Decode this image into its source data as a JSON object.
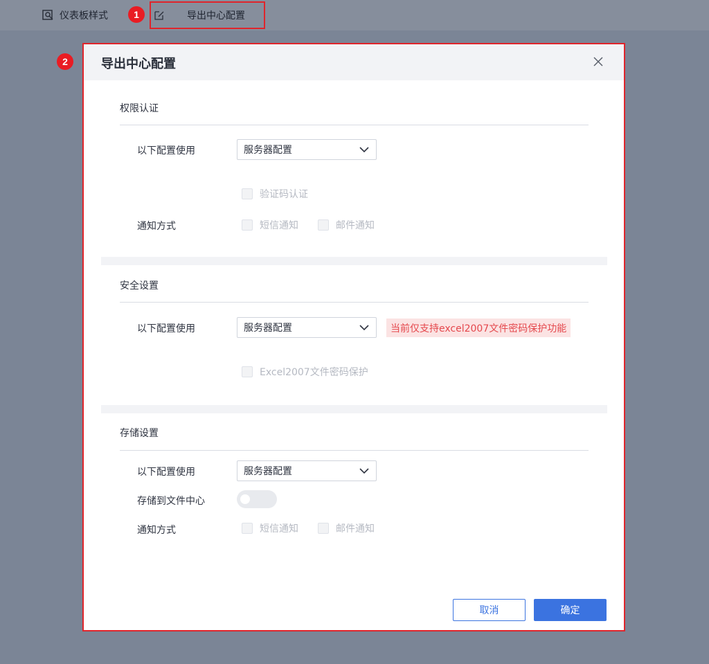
{
  "toolbar": {
    "dashboard_style_label": "仪表板样式",
    "export_center_label": "导出中心配置",
    "badge_1": "1",
    "badge_2": "2"
  },
  "dialog": {
    "title": "导出中心配置",
    "auth": {
      "title": "权限认证",
      "config_label": "以下配置使用",
      "config_value": "服务器配置",
      "captcha_label": "验证码认证",
      "notify_label": "通知方式",
      "sms_label": "短信通知",
      "email_label": "邮件通知"
    },
    "security": {
      "title": "安全设置",
      "config_label": "以下配置使用",
      "config_value": "服务器配置",
      "warning": "当前仅支持excel2007文件密码保护功能",
      "excel_pwd_label": "Excel2007文件密码保护"
    },
    "storage": {
      "title": "存储设置",
      "config_label": "以下配置使用",
      "config_value": "服务器配置",
      "save_to_center_label": "存储到文件中心",
      "save_to_center_on": false,
      "notify_label": "通知方式",
      "sms_label": "短信通知",
      "email_label": "邮件通知"
    },
    "cancel_label": "取消",
    "ok_label": "确定"
  },
  "colors": {
    "accent": "#3b73e0",
    "highlight_red": "#e0242b",
    "warning_text": "#e5484d"
  }
}
